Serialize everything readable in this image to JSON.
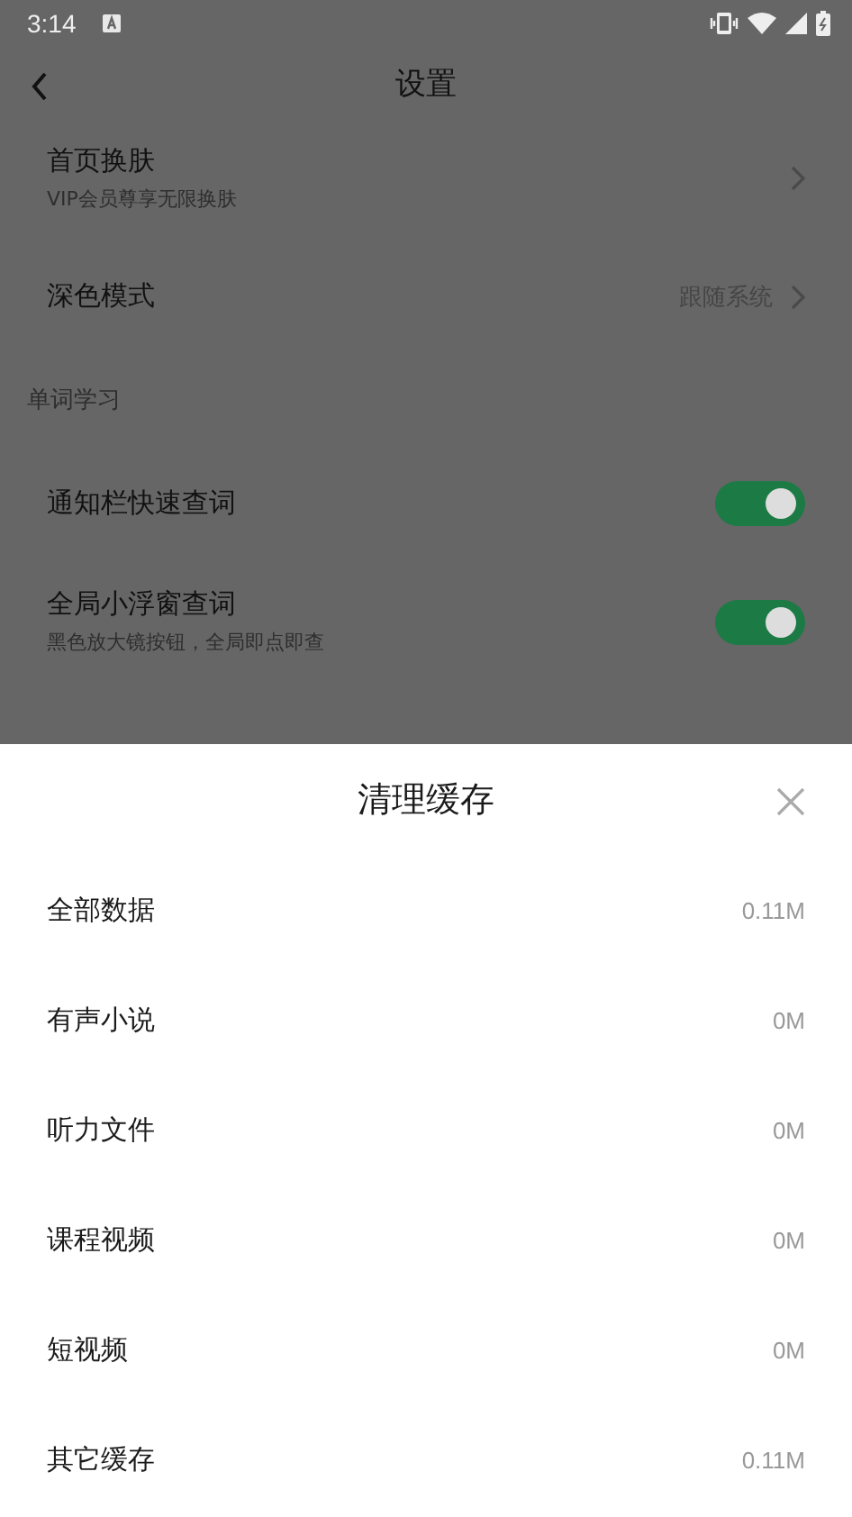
{
  "status_bar": {
    "time": "3:14"
  },
  "header": {
    "title": "设置"
  },
  "settings": [
    {
      "kind": "link",
      "label": "首页换肤",
      "subtitle": "VIP会员尊享无限换肤"
    },
    {
      "kind": "link",
      "label": "深色模式",
      "value": "跟随系统"
    },
    {
      "kind": "section",
      "label": "单词学习"
    },
    {
      "kind": "toggle",
      "label": "通知栏快速查词",
      "on": true
    },
    {
      "kind": "toggle",
      "label": "全局小浮窗查词",
      "subtitle": "黑色放大镜按钮，全局即点即查",
      "on": true
    }
  ],
  "sheet": {
    "title": "清理缓存",
    "items": [
      {
        "label": "全部数据",
        "size": "0.11M"
      },
      {
        "label": "有声小说",
        "size": "0M"
      },
      {
        "label": "听力文件",
        "size": "0M"
      },
      {
        "label": "课程视频",
        "size": "0M"
      },
      {
        "label": "短视频",
        "size": "0M"
      },
      {
        "label": "其它缓存",
        "size": "0.11M"
      }
    ]
  }
}
